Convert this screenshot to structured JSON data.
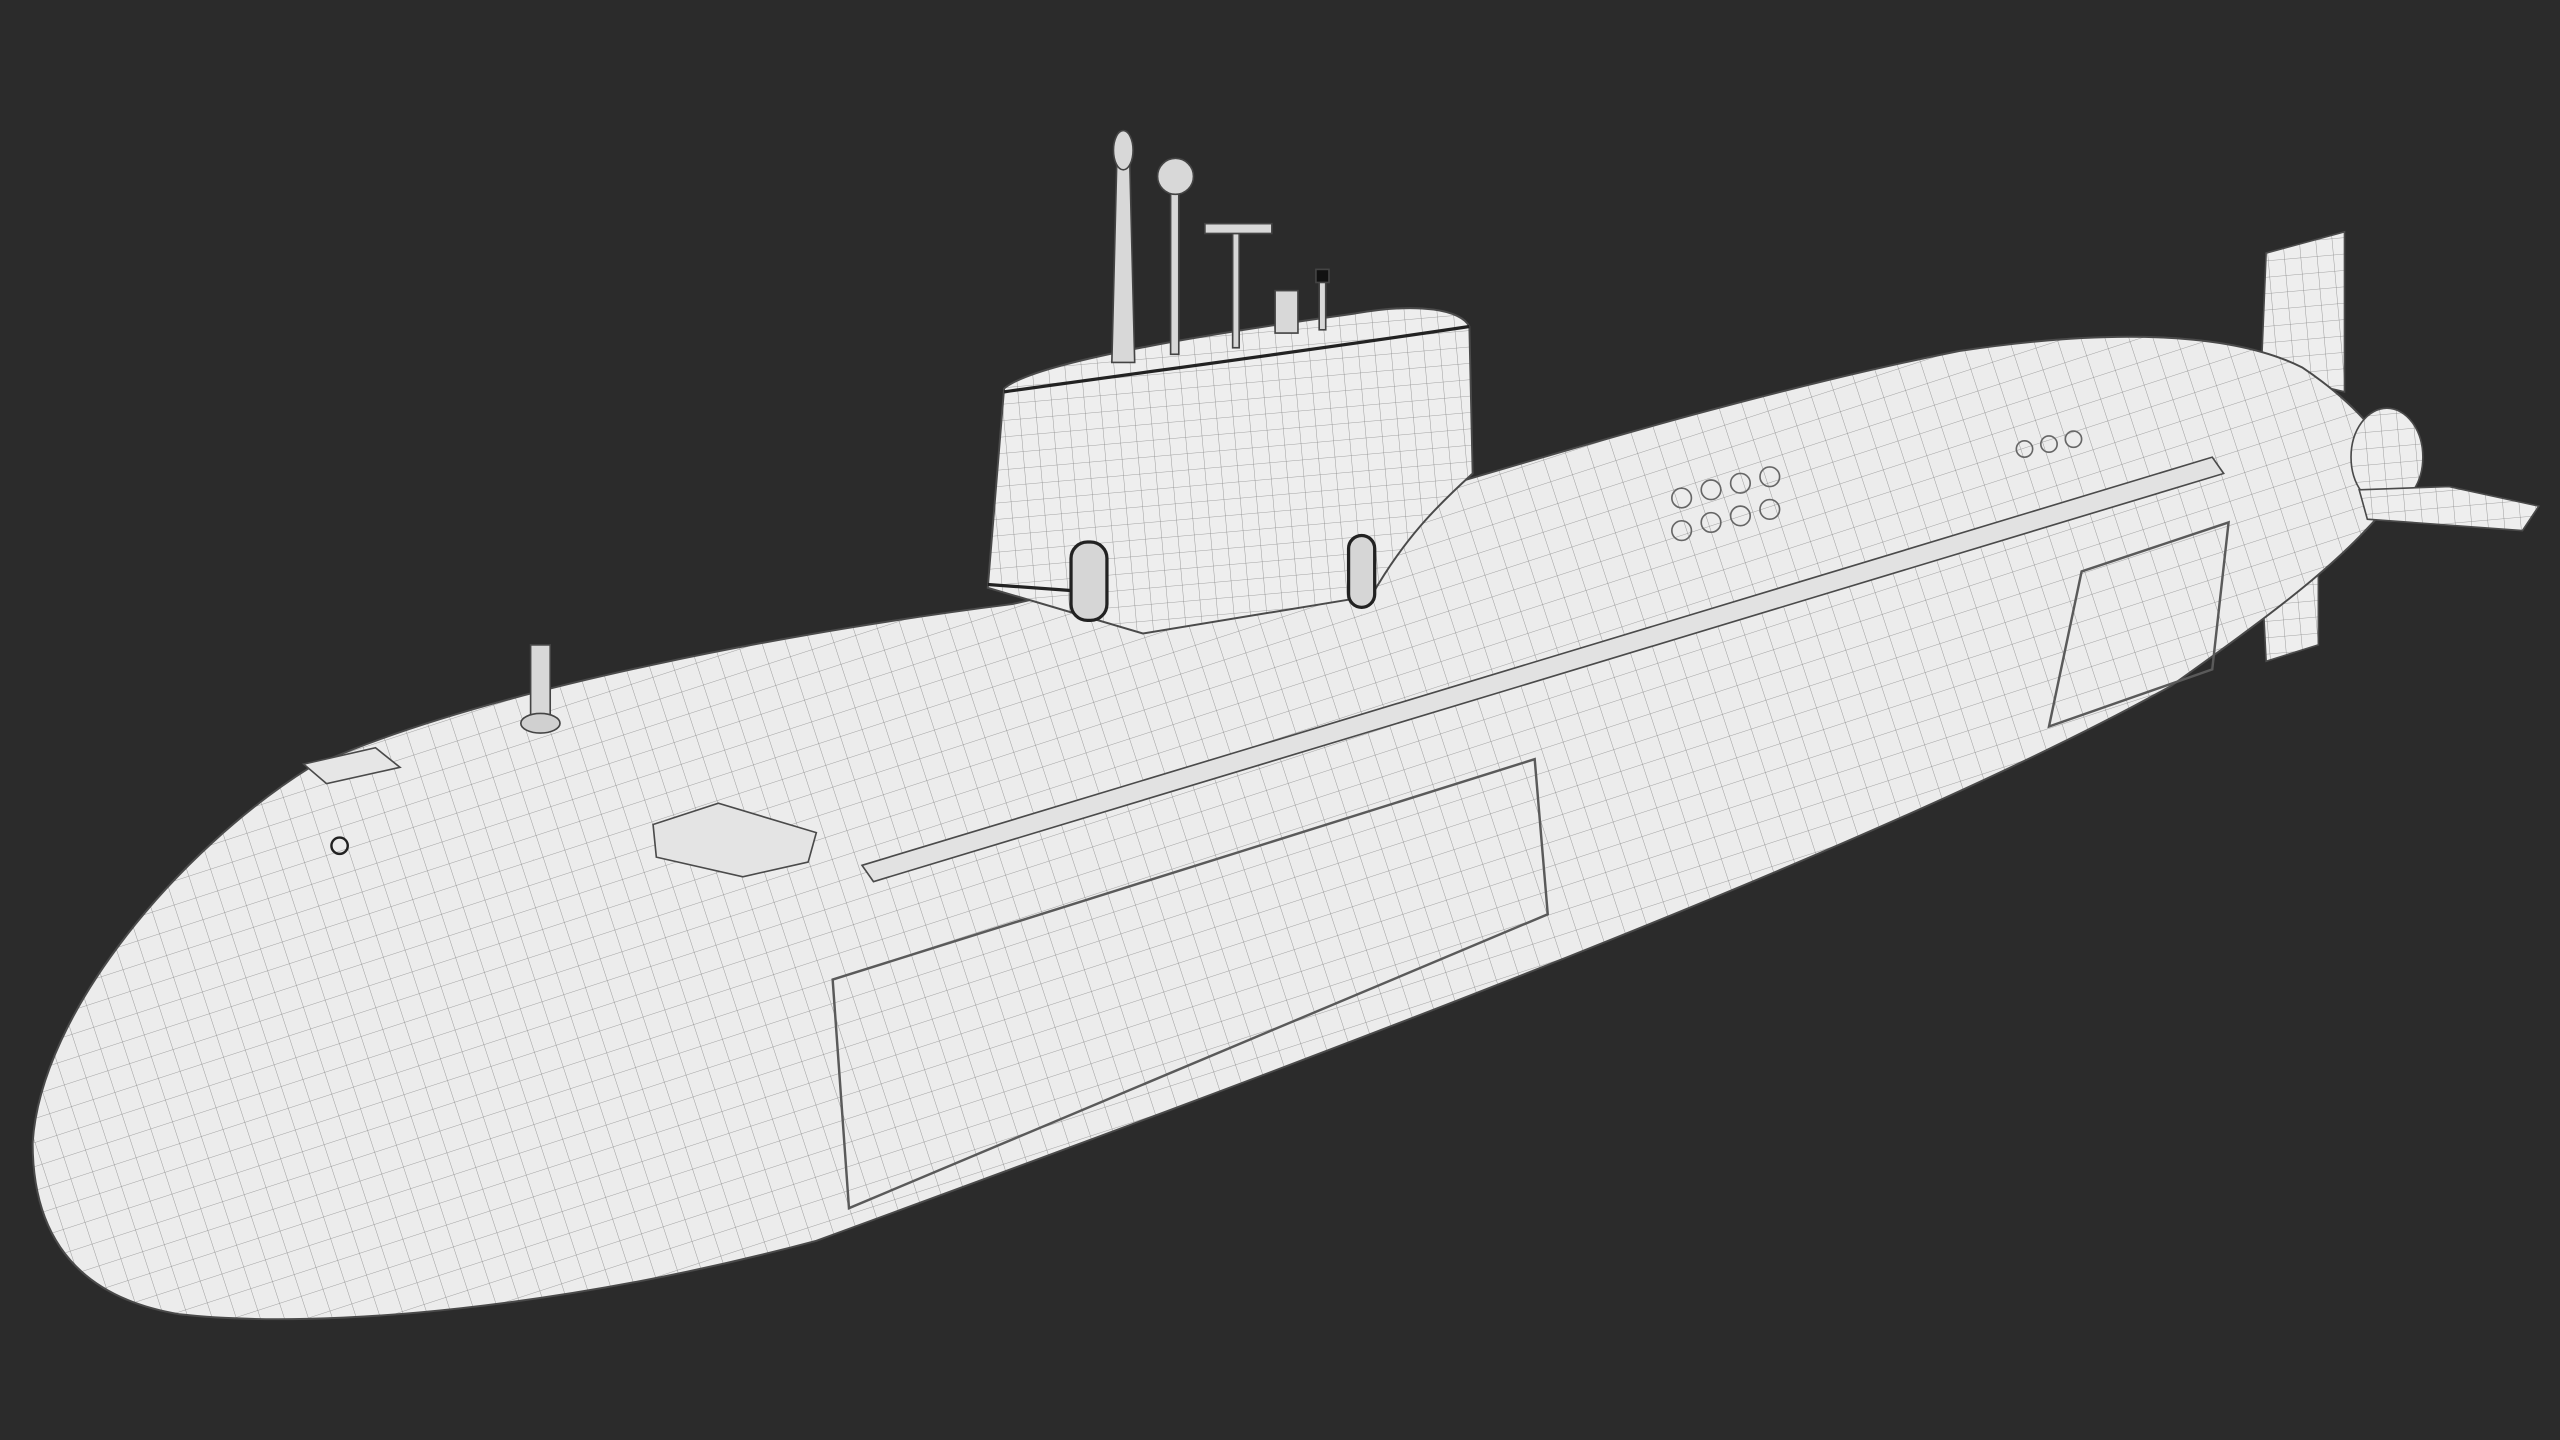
{
  "scene": {
    "subject": "submarine-wireframe",
    "colors": {
      "background": "#2b2b2b",
      "hull": "#ececec",
      "wire": "#8a8a8a",
      "edge": "#4a4a4a",
      "dark": "#1e1e1e"
    }
  }
}
